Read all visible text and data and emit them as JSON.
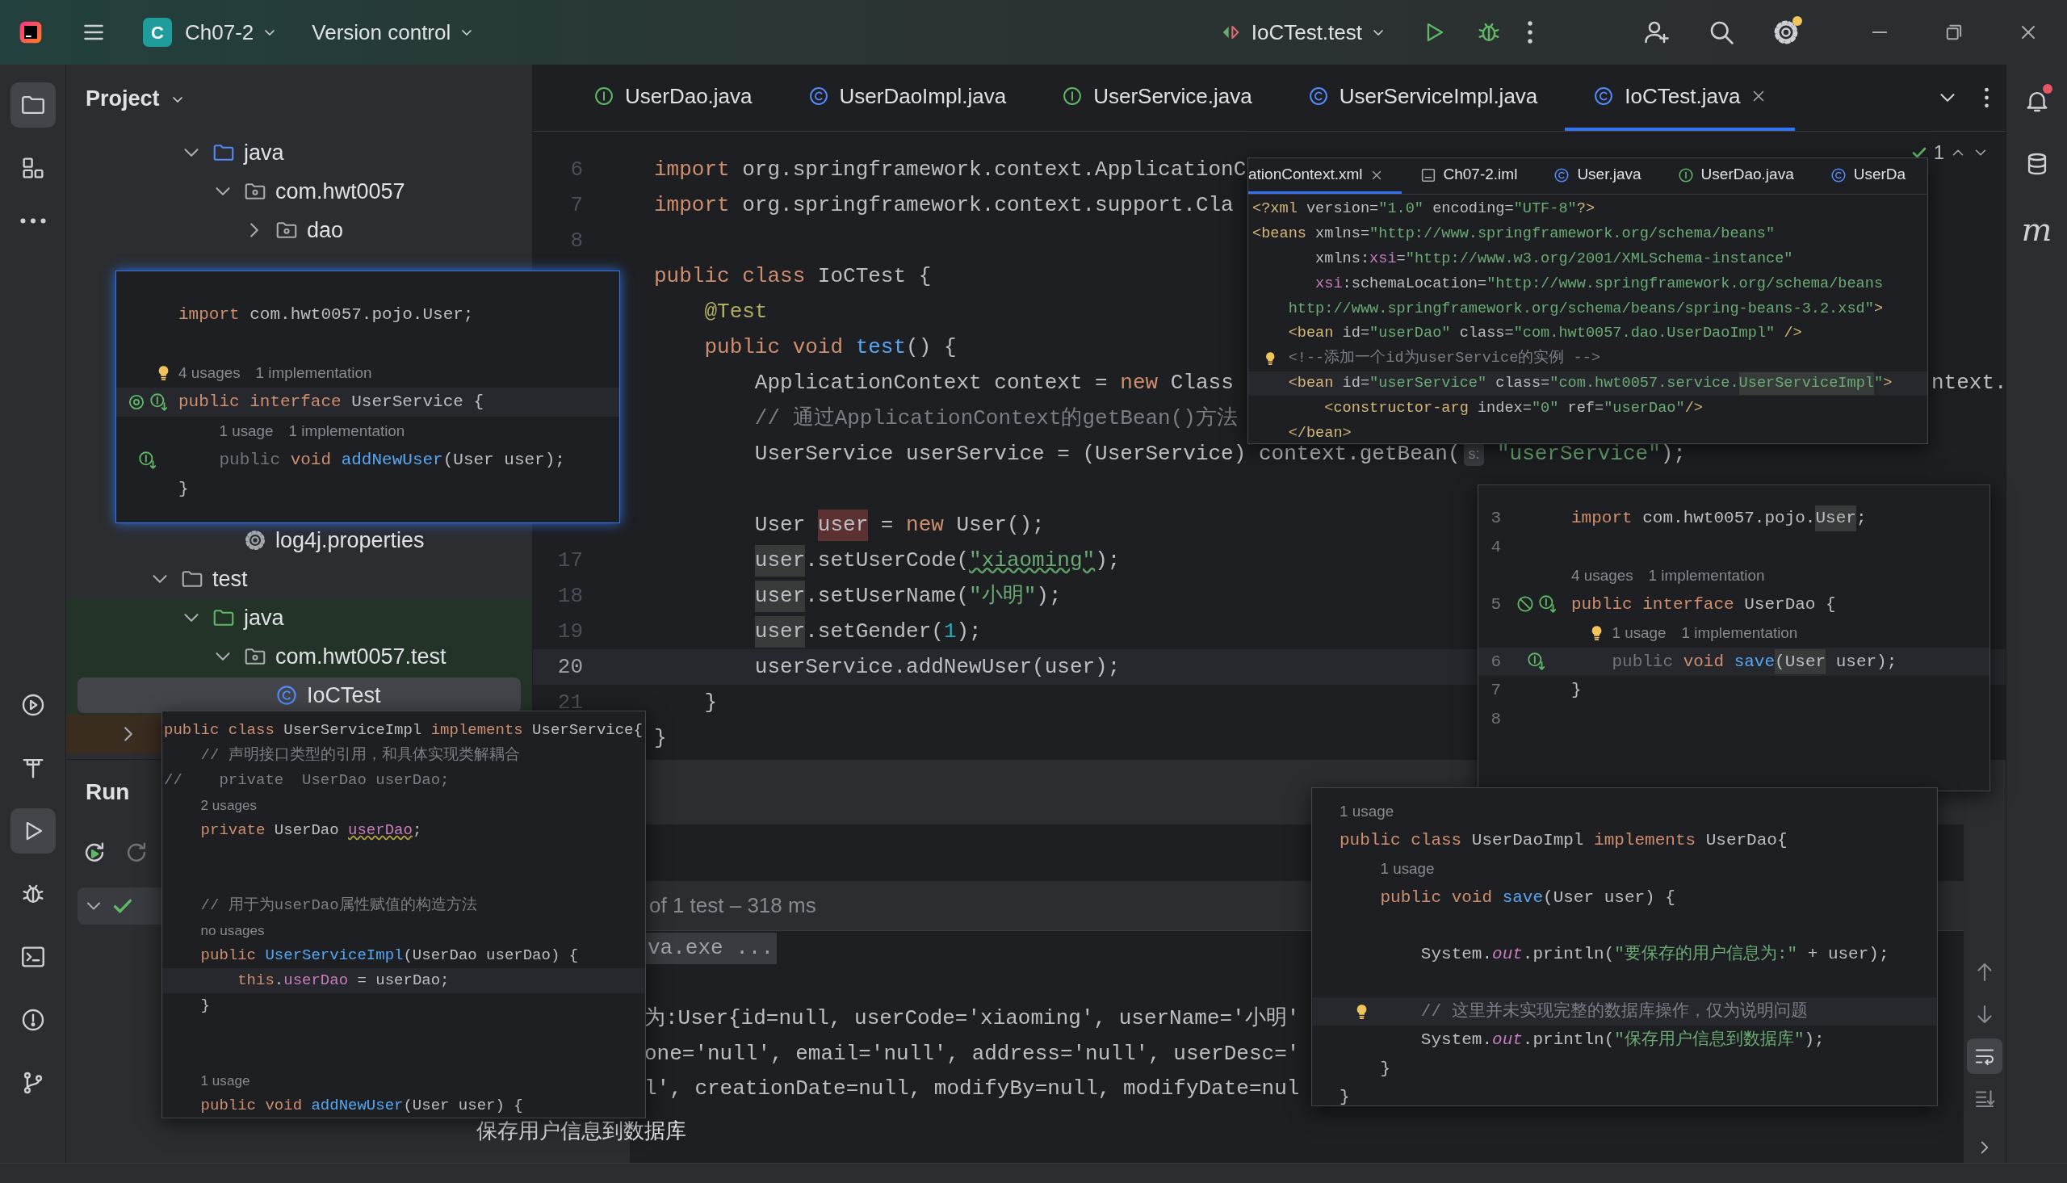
{
  "toolbar": {
    "project_badge": "C",
    "project": "Ch07-2",
    "vcs": "Version control",
    "run_config": "IoCTest.test",
    "settings_update": true
  },
  "left_tools": [
    {
      "selected": true
    },
    {
      "selected": false
    },
    {
      "selected": false
    }
  ],
  "left_tools_bottom": [
    {
      "selected": false
    },
    {
      "selected": false
    },
    {
      "selected": true
    },
    {
      "selected": false
    },
    {
      "selected": false
    },
    {
      "selected": false
    },
    {
      "selected": false
    }
  ],
  "right_tools": {
    "notifications_unread": true,
    "plugin": "m"
  },
  "project": {
    "title": "Project",
    "tree": [
      {
        "children": [
          {
            "children": [
              {
                "label": "java",
                "kind": "source-root",
                "expanded": true,
                "selected": false,
                "children": [
                  {
                    "label": "com.hwt0057",
                    "kind": "package",
                    "expanded": true,
                    "selected": false,
                    "children": [
                      {
                        "label": "dao",
                        "kind": "package",
                        "expanded": false,
                        "selected": false
                      },
                      {
                        "kind": "covered"
                      }
                    ]
                  }
                ]
              },
              {
                "children": [
                  {
                    "kind": "covered"
                  },
                  {
                    "kind": "covered"
                  },
                  {
                    "kind": "covered"
                  },
                  {
                    "kind": "covered"
                  },
                  {
                    "kind": "covered"
                  },
                  {
                    "kind": "covered"
                  },
                  {
                    "label": "log4j.properties",
                    "kind": "properties",
                    "selected": false
                  }
                ]
              }
            ]
          },
          {
            "label": "test",
            "kind": "folder",
            "expanded": true,
            "selected": false,
            "children": [
              {
                "label": "java",
                "kind": "test-root",
                "expanded": true,
                "selected": false,
                "children": [
                  {
                    "label": "com.hwt0057.test",
                    "kind": "package",
                    "expanded": true,
                    "selected": false,
                    "children": [
                      {
                        "label": "IoCTest",
                        "kind": "class",
                        "selected": true
                      }
                    ]
                  }
                ]
              }
            ]
          }
        ]
      },
      {
        "kind": "excluded-folder",
        "expanded": false,
        "selected": false
      }
    ]
  },
  "editor": {
    "tabs": [
      {
        "label": "UserDao.java",
        "kind": "interface",
        "selected": false
      },
      {
        "label": "UserDaoImpl.java",
        "kind": "class",
        "selected": false
      },
      {
        "label": "UserService.java",
        "kind": "interface",
        "selected": false
      },
      {
        "label": "UserServiceImpl.java",
        "kind": "class",
        "selected": false
      },
      {
        "label": "IoCTest.java",
        "kind": "class",
        "selected": true
      }
    ],
    "inspections": "1",
    "lines": [
      {
        "kind": "blank"
      },
      {
        "kind": "code",
        "num": "6",
        "current": false,
        "code": [
          {
            "text": "import",
            "kind": "keyword"
          },
          {
            "text": " org.springframework.context.ApplicationC",
            "kind": "plain"
          }
        ]
      },
      {
        "kind": "code",
        "num": "7",
        "current": false,
        "code": [
          {
            "text": "import",
            "kind": "keyword"
          },
          {
            "text": " org.springframework.context.support.Cla",
            "kind": "plain"
          }
        ]
      },
      {
        "kind": "blank",
        "num": "8"
      },
      {
        "kind": "code",
        "current": false,
        "code": [
          {
            "text": "public class",
            "kind": "keyword"
          },
          {
            "text": " IoCTest {",
            "kind": "plain"
          }
        ]
      },
      {
        "kind": "code",
        "current": false,
        "code": [
          {
            "text": "    @Test",
            "kind": "annotation"
          }
        ]
      },
      {
        "kind": "code",
        "current": false,
        "code": [
          {
            "text": "    public void",
            "kind": "keyword"
          },
          {
            "text": " test",
            "kind": "method"
          },
          {
            "text": "() {",
            "kind": "plain"
          }
        ]
      },
      {
        "kind": "code",
        "current": false,
        "code": [
          {
            "text": "        ApplicationContext context = ",
            "kind": "plain"
          },
          {
            "text": "new",
            "kind": "keyword"
          },
          {
            "text": " Class",
            "kind": "plain"
          }
        ],
        "tail": "ntext."
      },
      {
        "kind": "code",
        "current": false,
        "code": [
          {
            "text": "        // 通过ApplicationContext的getBean()方法",
            "kind": "comment"
          }
        ]
      },
      {
        "kind": "code",
        "current": false,
        "code": [
          {
            "text": "        UserService userService = (UserService) context.getBean(",
            "kind": "plain"
          },
          {
            "text": "s:",
            "kind": "inlay"
          },
          {
            "text": " \"userService\"",
            "kind": "string"
          },
          {
            "text": ");",
            "kind": "plain"
          }
        ]
      },
      {
        "kind": "blank"
      },
      {
        "kind": "code",
        "current": false,
        "code": [
          {
            "text": "        User ",
            "kind": "plain"
          },
          {
            "text": "user",
            "kind": "write"
          },
          {
            "text": " = ",
            "kind": "plain"
          },
          {
            "text": "new",
            "kind": "keyword"
          },
          {
            "text": " User();",
            "kind": "plain"
          }
        ]
      },
      {
        "kind": "code",
        "num": "17",
        "current": false,
        "code": [
          {
            "text": "        user",
            "kind": "read"
          },
          {
            "text": ".setUserCode(",
            "kind": "plain"
          },
          {
            "text": "\"xiaoming\"",
            "kind": "typo"
          },
          {
            "text": ");",
            "kind": "plain"
          }
        ]
      },
      {
        "kind": "code",
        "num": "18",
        "current": false,
        "code": [
          {
            "text": "        user",
            "kind": "read"
          },
          {
            "text": ".setUserName(",
            "kind": "plain"
          },
          {
            "text": "\"小明\"",
            "kind": "string"
          },
          {
            "text": ");",
            "kind": "plain"
          }
        ]
      },
      {
        "kind": "code",
        "num": "19",
        "current": false,
        "code": [
          {
            "text": "        user",
            "kind": "read"
          },
          {
            "text": ".setGender(",
            "kind": "plain"
          },
          {
            "text": "1",
            "kind": "number"
          },
          {
            "text": ");",
            "kind": "plain"
          }
        ]
      },
      {
        "kind": "code",
        "num": "20",
        "current": true,
        "code": [
          {
            "text": "        userService.addNewUser(user);",
            "kind": "plain"
          }
        ]
      },
      {
        "kind": "code",
        "num": "21",
        "current": false,
        "code": [
          {
            "text": "    }",
            "kind": "plain"
          }
        ]
      },
      {
        "kind": "code",
        "current": false,
        "code": [
          {
            "text": "}",
            "kind": "plain"
          }
        ]
      }
    ]
  },
  "popups": [
    {
      "lines": [
        {
          "kind": "blank"
        },
        {
          "kind": "code",
          "current": false,
          "code": [
            {
              "text": "import",
              "kind": "keyword"
            },
            {
              "text": " com.hwt0057.pojo.User;",
              "kind": "plain"
            }
          ]
        },
        {
          "kind": "blank"
        },
        {
          "kind": "hint",
          "hints": [
            "4 usages",
            "1 implementation"
          ],
          "gutter": [
            {
              "kind": "bulb"
            }
          ]
        },
        {
          "kind": "code",
          "current": true,
          "gutter": [
            {
              "kind": "override"
            },
            {
              "kind": "impl"
            }
          ],
          "code": [
            {
              "text": "public interface",
              "kind": "keyword"
            },
            {
              "text": " UserService {",
              "kind": "plain"
            }
          ]
        },
        {
          "kind": "hint",
          "hints": [
            "1 usage",
            "1 implementation"
          ]
        },
        {
          "kind": "code",
          "current": false,
          "gutter": [
            {
              "kind": "impl"
            }
          ],
          "code": [
            {
              "text": "    public",
              "kind": "modifier"
            },
            {
              "text": " void",
              "kind": "keyword"
            },
            {
              "text": " addNewUser",
              "kind": "method"
            },
            {
              "text": "(User user);",
              "kind": "plain"
            }
          ]
        },
        {
          "kind": "code",
          "current": false,
          "code": [
            {
              "text": "}",
              "kind": "plain"
            }
          ]
        }
      ]
    },
    {
      "tabs": [
        {
          "label": "ationContext.xml",
          "selected": true
        },
        {
          "label": "Ch07-2.iml",
          "kind": "module",
          "selected": false
        },
        {
          "label": "User.java",
          "kind": "class",
          "selected": false
        },
        {
          "label": "UserDao.java",
          "kind": "interface",
          "selected": false
        },
        {
          "label": "UserDa",
          "kind": "class",
          "selected": false
        }
      ],
      "lines": [
        {
          "kind": "code",
          "current": false,
          "code": [
            {
              "text": "<?xml",
              "kind": "tag"
            },
            {
              "text": " version=",
              "kind": "attribute"
            },
            {
              "text": "\"1.0\"",
              "kind": "string"
            },
            {
              "text": " encoding=",
              "kind": "attribute"
            },
            {
              "text": "\"UTF-8\"",
              "kind": "string"
            },
            {
              "text": "?>",
              "kind": "tag"
            }
          ]
        },
        {
          "kind": "code",
          "current": false,
          "code": [
            {
              "text": "<beans",
              "kind": "tag"
            },
            {
              "text": " xmlns=",
              "kind": "attribute"
            },
            {
              "text": "\"http://www.springframework.org/schema/beans\"",
              "kind": "string"
            }
          ]
        },
        {
          "kind": "code",
          "current": false,
          "code": [
            {
              "text": "       xmlns:",
              "kind": "attribute"
            },
            {
              "text": "xsi",
              "kind": "field"
            },
            {
              "text": "=",
              "kind": "attribute"
            },
            {
              "text": "\"http://www.w3.org/2001/XMLSchema-instance\"",
              "kind": "string"
            }
          ]
        },
        {
          "kind": "code",
          "current": false,
          "code": [
            {
              "text": "       xsi",
              "kind": "field"
            },
            {
              "text": ":schemaLocation=",
              "kind": "attribute"
            },
            {
              "text": "\"http://www.springframework.org/schema/beans",
              "kind": "string"
            }
          ]
        },
        {
          "kind": "code",
          "current": false,
          "code": [
            {
              "text": "    http://www.springframework.org/schema/beans/spring-beans-3.2.xsd\"",
              "kind": "string"
            },
            {
              "text": ">",
              "kind": "tag"
            }
          ]
        },
        {
          "kind": "code",
          "current": false,
          "code": [
            {
              "text": "    <bean",
              "kind": "tag"
            },
            {
              "text": " id=",
              "kind": "attribute"
            },
            {
              "text": "\"userDao\"",
              "kind": "string"
            },
            {
              "text": " class=",
              "kind": "attribute"
            },
            {
              "text": "\"com.hwt0057.dao.UserDaoImpl\"",
              "kind": "string"
            },
            {
              "text": " />",
              "kind": "tag"
            }
          ]
        },
        {
          "kind": "code",
          "current": false,
          "gutter": [
            {
              "kind": "bulb"
            }
          ],
          "code": [
            {
              "text": "    <!--添加一个id为userService的实例 -->",
              "kind": "comment"
            }
          ]
        },
        {
          "kind": "code",
          "current": true,
          "code": [
            {
              "text": "    <bean",
              "kind": "tag"
            },
            {
              "text": " id=",
              "kind": "attribute"
            },
            {
              "text": "\"userService\"",
              "kind": "string"
            },
            {
              "text": " class=",
              "kind": "attribute"
            },
            {
              "text": "\"com.hwt0057.service.",
              "kind": "string"
            },
            {
              "text": "UserServiceImpl",
              "kind": "match"
            },
            {
              "text": "\"",
              "kind": "string"
            },
            {
              "text": ">",
              "kind": "tag"
            }
          ]
        },
        {
          "kind": "code",
          "current": false,
          "code": [
            {
              "text": "        <constructor-arg",
              "kind": "tag"
            },
            {
              "text": " index=",
              "kind": "attribute"
            },
            {
              "text": "\"0\"",
              "kind": "string"
            },
            {
              "text": " ref=",
              "kind": "attribute"
            },
            {
              "text": "\"userDao\"",
              "kind": "string"
            },
            {
              "text": "/>",
              "kind": "tag"
            }
          ]
        },
        {
          "kind": "code",
          "current": false,
          "code": [
            {
              "text": "    </bean>",
              "kind": "tag"
            }
          ]
        }
      ]
    },
    {
      "lines": [
        {
          "kind": "code",
          "num": "3",
          "current": false,
          "code": [
            {
              "text": "import",
              "kind": "keyword"
            },
            {
              "text": " com.hwt0057.pojo.",
              "kind": "plain"
            },
            {
              "text": "User",
              "kind": "read"
            },
            {
              "text": ";",
              "kind": "plain"
            }
          ]
        },
        {
          "kind": "blank",
          "num": "4"
        },
        {
          "kind": "hint",
          "hints": [
            "4 usages",
            "1 implementation"
          ]
        },
        {
          "kind": "code",
          "num": "5",
          "current": false,
          "gutter": [
            {
              "kind": "unused"
            },
            {
              "kind": "impl"
            }
          ],
          "code": [
            {
              "text": "public interface",
              "kind": "keyword"
            },
            {
              "text": " UserDao {",
              "kind": "plain"
            }
          ]
        },
        {
          "kind": "hint",
          "hints": [
            "1 usage",
            "1 implementation"
          ],
          "gutter": [
            {
              "kind": "bulb"
            }
          ]
        },
        {
          "kind": "code",
          "num": "6",
          "current": true,
          "gutter": [
            {
              "kind": "impl"
            }
          ],
          "code": [
            {
              "text": "    public",
              "kind": "modifier"
            },
            {
              "text": " void",
              "kind": "keyword"
            },
            {
              "text": " save",
              "kind": "method"
            },
            {
              "text": "(User",
              "kind": "read"
            },
            {
              "text": " user);",
              "kind": "plain"
            }
          ]
        },
        {
          "kind": "code",
          "num": "7",
          "current": false,
          "code": [
            {
              "text": "}",
              "kind": "plain"
            }
          ]
        },
        {
          "kind": "blank",
          "num": "8"
        }
      ]
    },
    {
      "lines": [
        {
          "kind": "code",
          "current": false,
          "code": [
            {
              "text": "public class",
              "kind": "keyword"
            },
            {
              "text": " UserServiceImpl ",
              "kind": "plain"
            },
            {
              "text": "implements",
              "kind": "keyword"
            },
            {
              "text": " UserService{",
              "kind": "plain"
            }
          ]
        },
        {
          "kind": "code",
          "current": false,
          "code": [
            {
              "text": "    // 声明接口类型的引用，和具体实现类解耦合",
              "kind": "comment"
            }
          ]
        },
        {
          "kind": "code",
          "current": false,
          "code": [
            {
              "text": "//    private  UserDao userDao;",
              "kind": "comment"
            }
          ]
        },
        {
          "kind": "hint",
          "hints": [
            "2 usages"
          ]
        },
        {
          "kind": "code",
          "current": false,
          "code": [
            {
              "text": "    private",
              "kind": "keyword"
            },
            {
              "text": " UserDao ",
              "kind": "plain"
            },
            {
              "text": "userDao",
              "kind": "warned"
            },
            {
              "text": ";",
              "kind": "plain"
            }
          ]
        },
        {
          "kind": "blank"
        },
        {
          "kind": "blank"
        },
        {
          "kind": "code",
          "current": false,
          "code": [
            {
              "text": "    // 用于为userDao属性赋值的构造方法",
              "kind": "comment"
            }
          ]
        },
        {
          "kind": "hint",
          "hints": [
            "no usages"
          ]
        },
        {
          "kind": "code",
          "current": false,
          "code": [
            {
              "text": "    public",
              "kind": "keyword"
            },
            {
              "text": " UserServiceImpl",
              "kind": "method"
            },
            {
              "text": "(UserDao userDao) {",
              "kind": "plain"
            }
          ]
        },
        {
          "kind": "code",
          "current": true,
          "code": [
            {
              "text": "        this",
              "kind": "keyword"
            },
            {
              "text": ".",
              "kind": "plain"
            },
            {
              "text": "userDao",
              "kind": "field"
            },
            {
              "text": " = userDao;",
              "kind": "plain"
            }
          ]
        },
        {
          "kind": "code",
          "current": false,
          "code": [
            {
              "text": "    }",
              "kind": "plain"
            }
          ]
        },
        {
          "kind": "blank"
        },
        {
          "kind": "blank"
        },
        {
          "kind": "hint",
          "hints": [
            "1 usage"
          ]
        },
        {
          "kind": "code",
          "current": false,
          "code": [
            {
              "text": "    public void",
              "kind": "keyword"
            },
            {
              "text": " addNewUser",
              "kind": "method"
            },
            {
              "text": "(User user) {",
              "kind": "plain"
            }
          ]
        }
      ]
    },
    {
      "lines": [
        {
          "kind": "hint",
          "hints": [
            "1 usage"
          ]
        },
        {
          "kind": "code",
          "current": false,
          "code": [
            {
              "text": "public class",
              "kind": "keyword"
            },
            {
              "text": " UserDaoImpl ",
              "kind": "plain"
            },
            {
              "text": "implements",
              "kind": "keyword"
            },
            {
              "text": " UserDao{",
              "kind": "plain"
            }
          ]
        },
        {
          "kind": "hint",
          "hints": [
            "1 usage"
          ]
        },
        {
          "kind": "code",
          "current": false,
          "code": [
            {
              "text": "    public void",
              "kind": "keyword"
            },
            {
              "text": " save",
              "kind": "method"
            },
            {
              "text": "(User user) {",
              "kind": "plain"
            }
          ]
        },
        {
          "kind": "blank"
        },
        {
          "kind": "code",
          "current": false,
          "code": [
            {
              "text": "        System.",
              "kind": "plain"
            },
            {
              "text": "out",
              "kind": "static"
            },
            {
              "text": ".println(",
              "kind": "plain"
            },
            {
              "text": "\"要保存的用户信息为:\"",
              "kind": "string"
            },
            {
              "text": " + user);",
              "kind": "plain"
            }
          ]
        },
        {
          "kind": "blank"
        },
        {
          "kind": "code",
          "current": true,
          "gutter": [
            {
              "kind": "bulb"
            }
          ],
          "code": [
            {
              "text": "        // 这里并未实现完整的数据库操作，仅为说明问题",
              "kind": "comment"
            }
          ]
        },
        {
          "kind": "code",
          "current": false,
          "code": [
            {
              "text": "        System.",
              "kind": "plain"
            },
            {
              "text": "out",
              "kind": "static"
            },
            {
              "text": ".println(",
              "kind": "plain"
            },
            {
              "text": "\"保存用户信息到数据库\"",
              "kind": "string"
            },
            {
              "text": ");",
              "kind": "plain"
            }
          ]
        },
        {
          "kind": "code",
          "current": false,
          "code": [
            {
              "text": "    }",
              "kind": "plain"
            }
          ]
        },
        {
          "kind": "code",
          "current": false,
          "code": [
            {
              "text": "}",
              "kind": "plain"
            }
          ]
        }
      ]
    }
  ],
  "run": {
    "title": "Run",
    "tests": [
      {
        "passed": true,
        "expanded": true,
        "selected": true
      }
    ],
    "summary": "of 1 test – 318 ms",
    "console": [
      {
        "kind": "command",
        "text": "va.exe ..."
      },
      {
        "kind": "blank"
      },
      {
        "kind": "output",
        "text": "为:User{id=null, userCode='xiaoming', userName='小明'"
      },
      {
        "kind": "output",
        "text": "one='null', email='null', address='null', userDesc='"
      },
      {
        "kind": "output",
        "text": "l', creationDate=null, modifyBy=null, modifyDate=nul"
      }
    ],
    "fragment": "保存用户信息到数据库",
    "side_tools": [
      {
        "selected": false
      },
      {
        "selected": false
      },
      {
        "selected": true
      },
      {
        "selected": false
      }
    ]
  }
}
